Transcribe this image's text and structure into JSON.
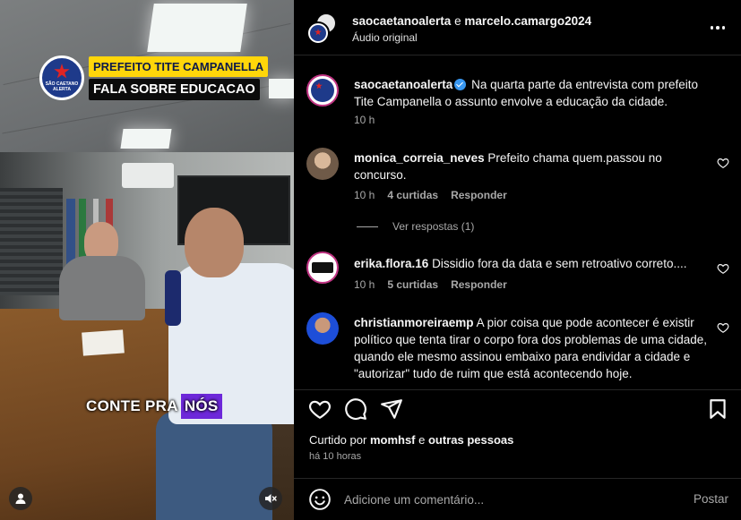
{
  "media": {
    "logo_text": "SÃO CAETANO ALERTA",
    "headline_line1": "PREFEITO TITE CAMPANELLA",
    "headline_line2": "FALA SOBRE EDUCACAO",
    "caption_part1": "CONTE PRA",
    "caption_part2": "NÓS",
    "profile_icon": "user-icon",
    "mute_icon": "speaker-muted-icon"
  },
  "header": {
    "user1": "saocaetanoalerta",
    "conjunction": "e",
    "user2": "marcelo.camargo2024",
    "audio": "Áudio original",
    "more_icon": "more-horizontal-icon"
  },
  "post": {
    "username": "saocaetanoalerta",
    "caption": "Na quarta parte da entrevista com prefeito Tite Campanella o assunto envolve a educação da cidade.",
    "time": "10 h"
  },
  "comments": [
    {
      "username": "monica_correia_neves",
      "text": "Prefeito chama quem.passou no concurso.",
      "time": "10 h",
      "likes": "4 curtidas",
      "reply": "Responder"
    },
    {
      "username": "erika.flora.16",
      "text": "Dissidio fora da data e sem retroativo correto....",
      "time": "10 h",
      "likes": "5 curtidas",
      "reply": "Responder"
    },
    {
      "username": "christianmoreiraemp",
      "text": "A pior coisa que pode acontecer é existir político que tenta tirar o corpo fora dos problemas de uma cidade, quando ele mesmo assinou embaixo para endividar a cidade e \"autorizar\" tudo de ruim que está acontecendo hoje."
    }
  ],
  "view_replies": "Ver respostas (1)",
  "liked_by": {
    "prefix": "Curtido por",
    "user": "momhsf",
    "conjunction": "e",
    "others": "outras pessoas"
  },
  "post_time": "há 10 horas",
  "add_comment": {
    "placeholder": "Adicione um comentário...",
    "post_label": "Postar"
  },
  "colors": {
    "background": "#000000",
    "text": "#f5f5f5",
    "muted": "#a8a8a8",
    "verified": "#3897f0",
    "headline_yellow": "#ffd60a",
    "caption_purple": "#6d28d9"
  }
}
